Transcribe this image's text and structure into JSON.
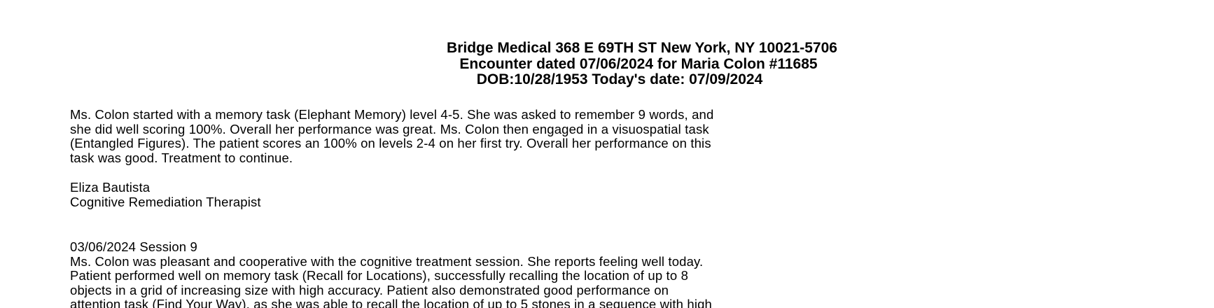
{
  "header": {
    "line1": "Bridge Medical 368 E 69TH ST New York, NY 10021-5706",
    "line2": "Encounter dated 07/06/2024 for Maria Colon #11685",
    "line3": "DOB:10/28/1953  Today's date: 07/09/2024"
  },
  "note": {
    "lines": [
      "Ms. Colon started with a memory task (Elephant Memory) level 4-5. She was asked to remember 9 words, and",
      "she did well scoring 100%. Overall her performance was great. Ms. Colon then engaged in a visuospatial task",
      "(Entangled Figures). The patient scores an 100% on levels 2-4 on her first try. Overall her performance on this",
      "task was good. Treatment to continue."
    ]
  },
  "signature": {
    "name": "Eliza Bautista",
    "title": "Cognitive Remediation Therapist"
  },
  "session": {
    "heading": "03/06/2024 Session 9",
    "lines": [
      "Ms. Colon was pleasant and cooperative with the cognitive treatment session. She reports feeling well today.",
      "Patient performed well on memory task (Recall for Locations), successfully recalling the location of up to 8",
      "objects in a grid of increasing size with high accuracy.  Patient also demonstrated good performance on",
      "attention task (Find Your Way), as she was able to recall the location of up to 5 stones in a sequence with high"
    ]
  }
}
